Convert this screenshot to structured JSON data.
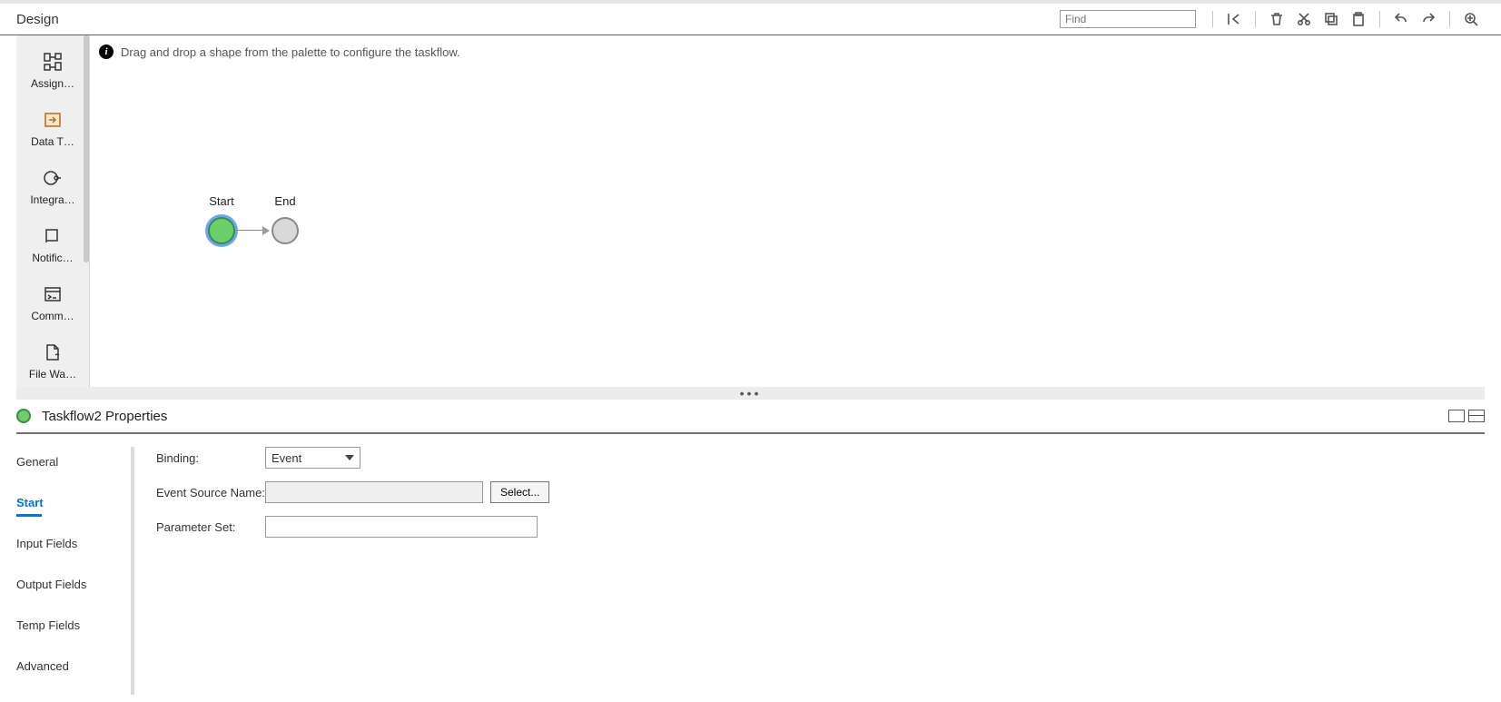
{
  "topbar": {
    "title": "Design",
    "find_placeholder": "Find"
  },
  "palette": {
    "items": [
      {
        "label": "Assign…",
        "icon": "assign"
      },
      {
        "label": "Data T…",
        "icon": "datatask"
      },
      {
        "label": "Integra…",
        "icon": "integration"
      },
      {
        "label": "Notific…",
        "icon": "notification"
      },
      {
        "label": "Comm…",
        "icon": "command"
      },
      {
        "label": "File Wa…",
        "icon": "filewatch"
      }
    ]
  },
  "canvas": {
    "hint": "Drag and drop a shape from the palette to configure the taskflow.",
    "nodes": {
      "start": "Start",
      "end": "End"
    }
  },
  "properties": {
    "title": "Taskflow2 Properties",
    "tabs": [
      "General",
      "Start",
      "Input Fields",
      "Output Fields",
      "Temp Fields",
      "Advanced"
    ],
    "active_tab": "Start",
    "form": {
      "binding_label": "Binding:",
      "binding_value": "Event",
      "event_source_label": "Event Source Name:",
      "event_source_value": "",
      "select_button": "Select...",
      "param_set_label": "Parameter Set:",
      "param_set_value": ""
    }
  }
}
